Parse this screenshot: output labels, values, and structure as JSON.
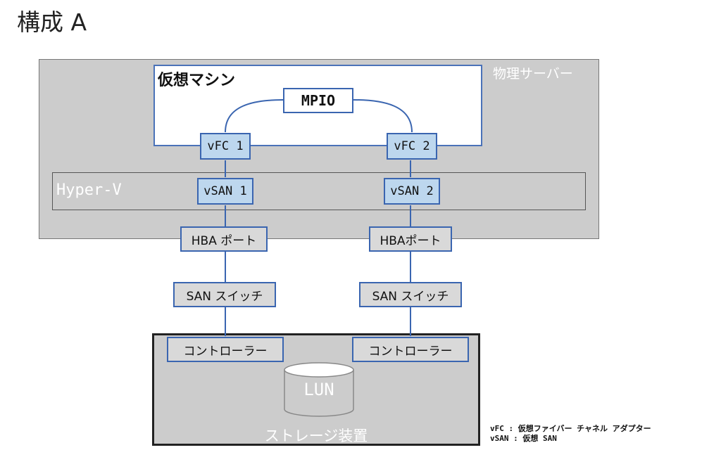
{
  "title": "構成 A",
  "server_label": "物理サーバー",
  "vm_label": "仮想マシン",
  "mpio": "MPIO",
  "vfc1": "vFC 1",
  "vfc2": "vFC 2",
  "hyperv": "Hyper-V",
  "vsan1": "vSAN 1",
  "vsan2": "vSAN 2",
  "hba1": "HBA ポート",
  "hba2": "HBAポート",
  "switch1": "SAN スイッチ",
  "switch2": "SAN スイッチ",
  "ctrl1": "コントローラー",
  "ctrl2": "コントローラー",
  "lun": "LUN",
  "storage_label": "ストレージ装置",
  "legend": {
    "line1": "vFC : 仮想ファイバー チャネル アダプター",
    "line2": "vSAN : 仮想 SAN"
  },
  "colors": {
    "line_blue": "#3a65b0",
    "vfc_fill": "#bdd7ee",
    "box_gray": "#d9d9d9",
    "panel_gray": "#cccccc"
  }
}
